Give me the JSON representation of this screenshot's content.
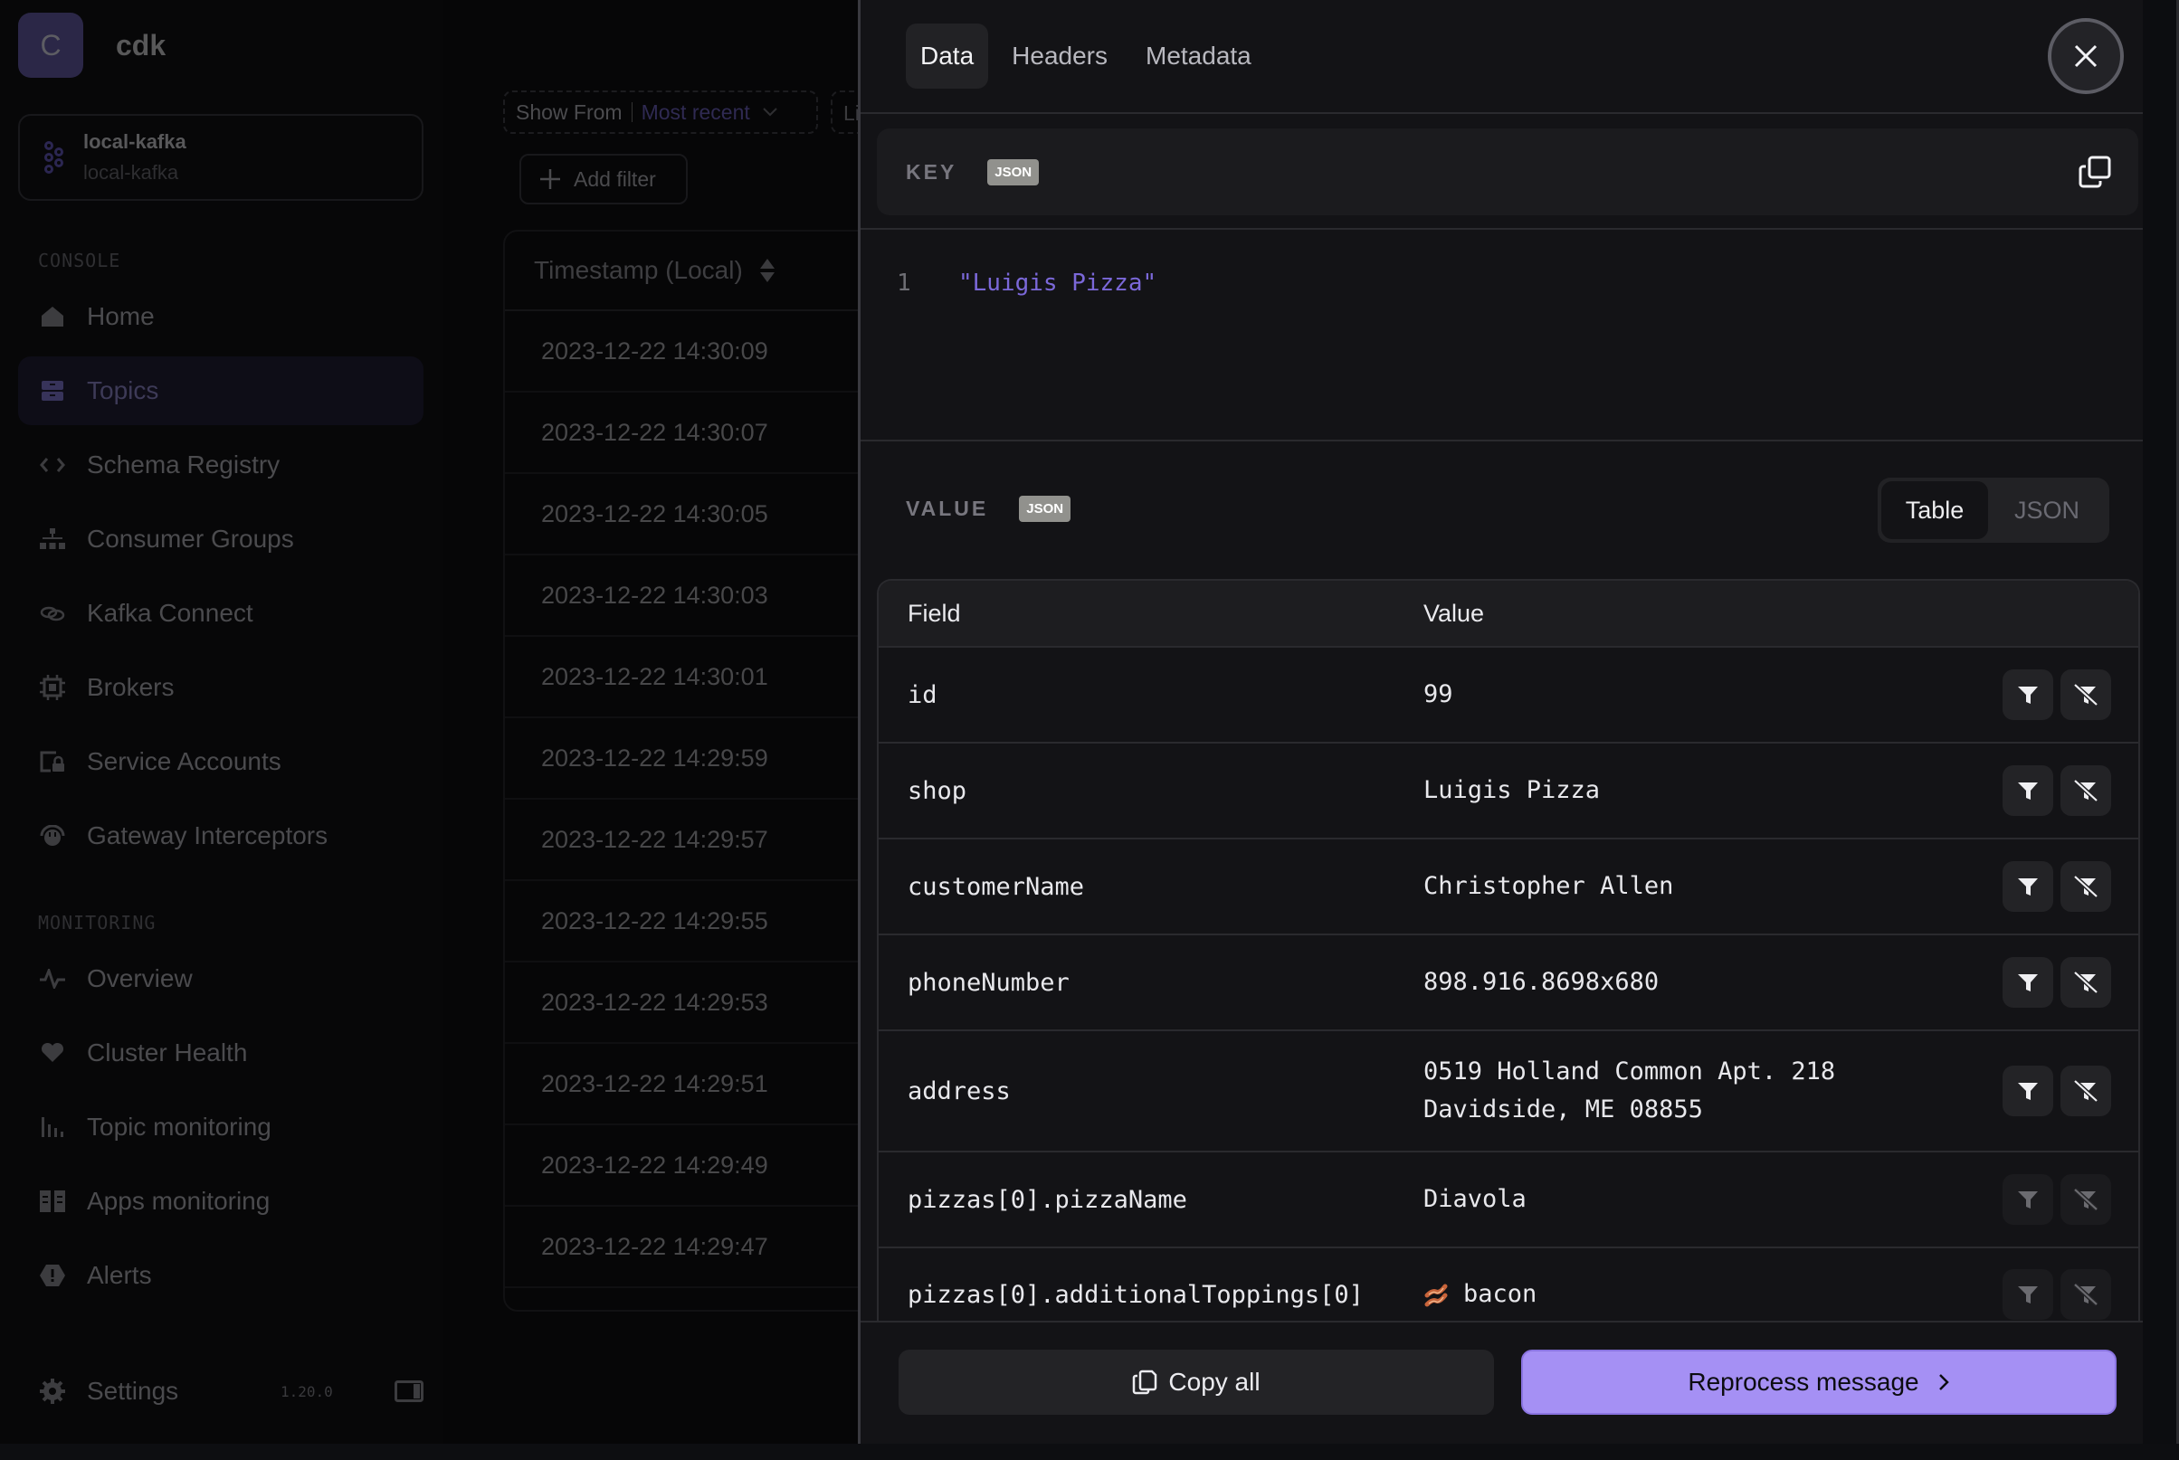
{
  "app": {
    "avatar_letter": "C",
    "name": "cdk",
    "cluster": {
      "name": "local-kafka",
      "subtitle": "local-kafka"
    },
    "version": "1.20.0"
  },
  "sidebar": {
    "console_label": "CONSOLE",
    "console_items": [
      {
        "label": "Home",
        "icon": "home-icon"
      },
      {
        "label": "Topics",
        "icon": "topics-icon",
        "active": true
      },
      {
        "label": "Schema Registry",
        "icon": "code-icon"
      },
      {
        "label": "Consumer Groups",
        "icon": "hierarchy-icon"
      },
      {
        "label": "Kafka Connect",
        "icon": "link-icon"
      },
      {
        "label": "Brokers",
        "icon": "chip-icon"
      },
      {
        "label": "Service Accounts",
        "icon": "service-account-icon"
      },
      {
        "label": "Gateway Interceptors",
        "icon": "interceptor-icon"
      }
    ],
    "monitoring_label": "MONITORING",
    "monitoring_items": [
      {
        "label": "Overview",
        "icon": "pulse-icon"
      },
      {
        "label": "Cluster Health",
        "icon": "heart-icon"
      },
      {
        "label": "Topic monitoring",
        "icon": "bar-chart-icon"
      },
      {
        "label": "Apps monitoring",
        "icon": "apps-icon"
      },
      {
        "label": "Alerts",
        "icon": "alert-icon"
      }
    ],
    "settings_label": "Settings"
  },
  "toolbar": {
    "show_from_label": "Show From",
    "show_from_value": "Most recent",
    "limit_label_partial": "Li",
    "add_filter_label": "Add filter"
  },
  "messages": {
    "column_header": "Timestamp (Local)",
    "rows": [
      "2023-12-22 14:30:09",
      "2023-12-22 14:30:07",
      "2023-12-22 14:30:05",
      "2023-12-22 14:30:03",
      "2023-12-22 14:30:01",
      "2023-12-22 14:29:59",
      "2023-12-22 14:29:57",
      "2023-12-22 14:29:55",
      "2023-12-22 14:29:53",
      "2023-12-22 14:29:51",
      "2023-12-22 14:29:49",
      "2023-12-22 14:29:47"
    ]
  },
  "drawer": {
    "tabs": [
      {
        "label": "Data",
        "active": true
      },
      {
        "label": "Headers",
        "active": false
      },
      {
        "label": "Metadata",
        "active": false
      }
    ],
    "key": {
      "label": "KEY",
      "format": "JSON",
      "line_number": "1",
      "content": "\"Luigis Pizza\""
    },
    "value": {
      "label": "VALUE",
      "format": "JSON",
      "view_options": [
        "Table",
        "JSON"
      ],
      "selected_view": "Table",
      "table": {
        "headers": [
          "Field",
          "Value"
        ],
        "rows": [
          {
            "field": "id",
            "value": "99",
            "filters_enabled": true
          },
          {
            "field": "shop",
            "value": "Luigis Pizza",
            "filters_enabled": true
          },
          {
            "field": "customerName",
            "value": "Christopher Allen",
            "filters_enabled": true
          },
          {
            "field": "phoneNumber",
            "value": "898.916.8698x680",
            "filters_enabled": true
          },
          {
            "field": "address",
            "value_lines": [
              "0519 Holland Common Apt. 218",
              "Davidside, ME 08855"
            ],
            "filters_enabled": true
          },
          {
            "field": "pizzas[0].pizzaName",
            "value": "Diavola",
            "filters_enabled": false
          },
          {
            "field": "pizzas[0].additionalToppings[0]",
            "value": "bacon",
            "value_icon": "bacon-emoji",
            "filters_enabled": false
          }
        ]
      }
    },
    "footer": {
      "copy_all_label": "Copy all",
      "reprocess_label": "Reprocess message"
    }
  },
  "colors": {
    "accent": "#a590f4",
    "code_string": "#7b68d9",
    "drawer_bg": "#131316"
  }
}
